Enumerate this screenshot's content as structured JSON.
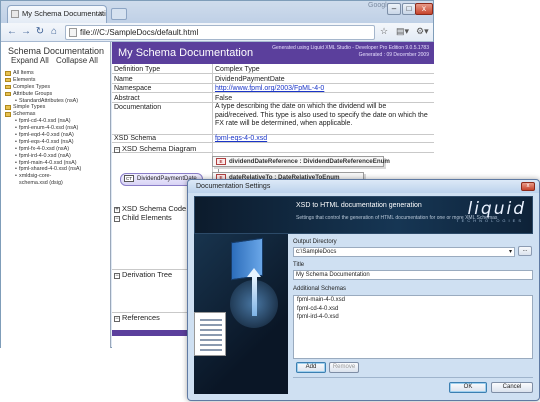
{
  "browser": {
    "tab_title": "My Schema Documentati...",
    "brand": "Google",
    "address": "file:///C:/SampleDocs/default.html",
    "window_buttons": [
      "–",
      "□",
      "x"
    ]
  },
  "left_pane": {
    "title": "Schema Documentation",
    "links": [
      "Expand All",
      "Collapse All"
    ],
    "tree": [
      {
        "label": "All Items",
        "level": 1
      },
      {
        "label": "Elements",
        "level": 1
      },
      {
        "label": "Complex Types",
        "level": 1
      },
      {
        "label": "Attribute Groups",
        "level": 1
      },
      {
        "label": "StandardAttributes (nsA)",
        "level": 2
      },
      {
        "label": "Simple Types",
        "level": 1
      },
      {
        "label": "Schemas",
        "level": 1
      },
      {
        "label": "fpml-cd-4-0.xsd (nsA)",
        "level": 2
      },
      {
        "label": "fpml-enum-4-0.xsd (nsA)",
        "level": 2
      },
      {
        "label": "fpml-eqd-4-0.xsd (nsA)",
        "level": 2
      },
      {
        "label": "fpml-eqs-4-0.xsd (nsA)",
        "level": 2
      },
      {
        "label": "fpml-fx-4-0.xsd (nsA)",
        "level": 2
      },
      {
        "label": "fpml-ird-4-0.xsd (nsA)",
        "level": 2
      },
      {
        "label": "fpml-main-4-0.xsd (nsA)",
        "level": 2
      },
      {
        "label": "fpml-shared-4-0.xsd (nsA)",
        "level": 2
      },
      {
        "label": "xmldsig-core-",
        "level": 2
      },
      {
        "label": "schema.xsd (dsig)",
        "level": 2
      }
    ]
  },
  "doc": {
    "title": "My Schema Documentation",
    "generated_line1": "Generated using Liquid XML Studio - Developer Pro Edition 9.0.5.1783",
    "generated_line2": "Generated : 09 December 2009",
    "rows": [
      {
        "key": "Definition Type",
        "value": "Complex Type",
        "link": false
      },
      {
        "key": "Name",
        "value": "DividendPaymentDate",
        "link": false
      },
      {
        "key": "Namespace",
        "value": "http://www.fpml.org/2003/FpML-4-0",
        "link": true
      },
      {
        "key": "Abstract",
        "value": "False",
        "link": false
      }
    ],
    "documentation_label": "Documentation",
    "documentation_text": "A type describing the date on which the dividend will be paid/received. This type is also used to specify the date on which the FX rate will be determined, when applicable.",
    "xsd_schema_label": "XSD Schema",
    "xsd_schema_value": "fpml-eqs-4-0.xsd",
    "sections": [
      "XSD Schema Diagram",
      "XSD Schema Code",
      "Child Elements",
      "Derivation Tree",
      "References"
    ],
    "diagram": {
      "root": "DividendPaymentDate",
      "root_badge": "CT",
      "children": [
        {
          "badge": "E",
          "label": "dividendDateReference : DividendDateReferenceEnum"
        },
        {
          "badge": "E",
          "label": "dateRelativeTo : DateRelativeToEnum"
        }
      ]
    }
  },
  "dialog": {
    "title": "Documentation Settings",
    "header_title": "XSD to HTML documentation generation",
    "header_subtitle": "Settings that control the generation of HTML documentation for one or more XML Schemas",
    "logo": "liquid",
    "logo_sub": "TECHNOLOGIES",
    "output_dir_label": "Output Directory",
    "output_dir_value": "c:\\SampleDocs",
    "browse_label": "...",
    "title_label": "Title",
    "title_value": "My Schema Documentation",
    "schemas_label": "Additional Schemas",
    "schemas": [
      "fpml-main-4-0.xsd",
      "fpml-cd-4-0.xsd",
      "fpml-ird-4-0.xsd"
    ],
    "add_label": "Add",
    "remove_label": "Remove",
    "ok_label": "OK",
    "cancel_label": "Cancel",
    "close_label": "x"
  }
}
